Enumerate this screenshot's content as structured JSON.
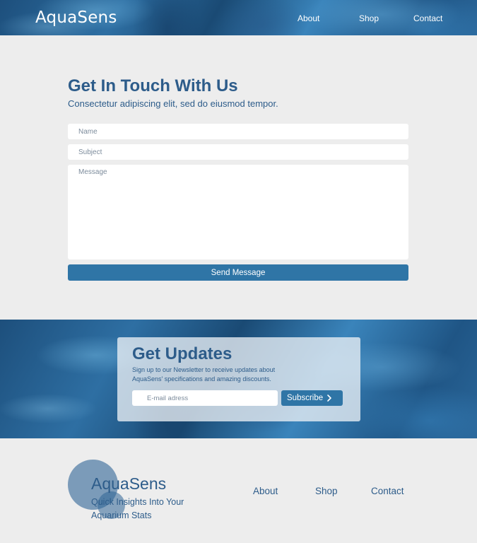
{
  "header": {
    "brand": "AquaSens",
    "nav": [
      "About",
      "Shop",
      "Contact"
    ]
  },
  "contact": {
    "title": "Get In Touch With Us",
    "subtitle": "Consectetur adipiscing elit, sed do eiusmod tempor.",
    "name_placeholder": "Name",
    "subject_placeholder": "Subject",
    "message_placeholder": "Message",
    "send_label": "Send Message"
  },
  "newsletter": {
    "title": "Get Updates",
    "text": "Sign up to our Newsletter to receive updates about AquaSens' specifications and amazing discounts.",
    "email_placeholder": "E-mail adress",
    "subscribe_label": "Subscribe",
    "icon": "chevron-right-icon"
  },
  "footer": {
    "brand": "AquaSens",
    "tagline": "Quick Insights Into Your Aquarium Stats",
    "nav": [
      "About",
      "Shop",
      "Contact"
    ]
  },
  "colors": {
    "primary": "#2f75a6",
    "text": "#2d5c8a",
    "background": "#ededed"
  }
}
